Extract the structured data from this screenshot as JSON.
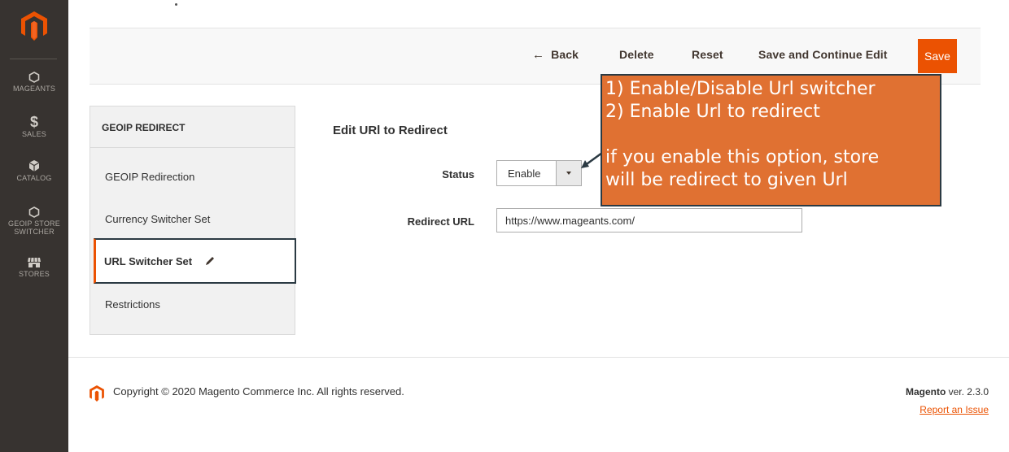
{
  "sidebar": {
    "items": [
      {
        "label": "MAGEANTS",
        "icon": "hexagon-icon"
      },
      {
        "label": "SALES",
        "icon": "dollar-icon"
      },
      {
        "label": "CATALOG",
        "icon": "box-icon"
      },
      {
        "label": "GEOIP STORE",
        "label2": "SWITCHER",
        "icon": "hexagon-icon"
      },
      {
        "label": "STORES",
        "icon": "store-icon"
      }
    ]
  },
  "actions": {
    "back": "Back",
    "delete": "Delete",
    "reset": "Reset",
    "save_continue": "Save and Continue Edit",
    "save": "Save"
  },
  "tabs": {
    "title": "GEOIP REDIRECT",
    "items": [
      "GEOIP Redirection",
      "Currency Switcher Set",
      "URL Switcher Set",
      "Restrictions"
    ]
  },
  "form": {
    "title": "Edit URl to Redirect",
    "status_label": "Status",
    "status_value": "Enable",
    "url_label": "Redirect URL",
    "url_value": "https://www.mageants.com/"
  },
  "annotation": {
    "line1": "1) Enable/Disable Url switcher",
    "line2": "2) Enable Url to redirect",
    "line3": "if you enable this option, store",
    "line4": "will be redirect to given Url"
  },
  "footer": {
    "copyright": "Copyright © 2020 Magento Commerce Inc. All rights reserved.",
    "brand": "Magento",
    "version": " ver. 2.3.0",
    "report": "Report an Issue"
  },
  "colors": {
    "accent": "#eb5202",
    "sidebar": "#373330",
    "callout": "#e07132"
  }
}
